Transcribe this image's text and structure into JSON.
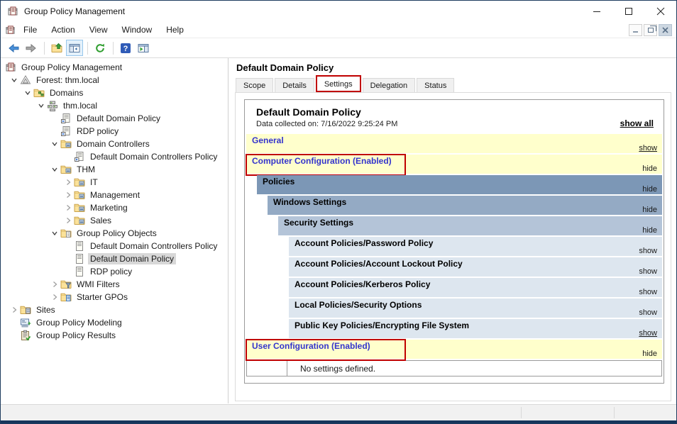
{
  "window": {
    "title": "Group Policy Management",
    "controls": [
      {
        "name": "minimize-button",
        "icon": "minimize-icon"
      },
      {
        "name": "maximize-button",
        "icon": "maximize-icon"
      },
      {
        "name": "close-button",
        "icon": "close-icon"
      }
    ]
  },
  "menu": {
    "items": [
      "File",
      "Action",
      "View",
      "Window",
      "Help"
    ],
    "mdi_controls": [
      {
        "name": "mdi-minimize-button",
        "icon": "minimize-icon"
      },
      {
        "name": "mdi-restore-button",
        "icon": "restore-icon"
      },
      {
        "name": "mdi-close-button",
        "icon": "close-icon"
      }
    ]
  },
  "toolbar": {
    "buttons": [
      {
        "name": "back-button",
        "icon": "back-arrow-icon"
      },
      {
        "name": "forward-button",
        "icon": "forward-arrow-icon"
      },
      {
        "sep": true
      },
      {
        "name": "up-one-level-button",
        "icon": "folder-up-icon"
      },
      {
        "name": "show-console-tree-button",
        "icon": "console-tree-icon",
        "active": true
      },
      {
        "sep": true
      },
      {
        "name": "refresh-button",
        "icon": "refresh-icon"
      },
      {
        "sep": true
      },
      {
        "name": "help-button",
        "icon": "help-icon"
      },
      {
        "name": "show-action-pane-button",
        "icon": "action-pane-icon"
      }
    ]
  },
  "tree": {
    "items": [
      {
        "label": "Group Policy Management",
        "level": 0,
        "chevron": "none",
        "icon": "gpmc-console-icon"
      },
      {
        "label": "Forest: thm.local",
        "level": 1,
        "chevron": "expanded",
        "icon": "forest-icon"
      },
      {
        "label": "Domains",
        "level": 2,
        "chevron": "expanded",
        "icon": "domains-folder-icon"
      },
      {
        "label": "thm.local",
        "level": 3,
        "chevron": "expanded",
        "icon": "domain-icon"
      },
      {
        "label": "Default Domain Policy",
        "level": 4,
        "chevron": "empty",
        "icon": "gpo-link-icon"
      },
      {
        "label": "RDP policy",
        "level": 4,
        "chevron": "empty",
        "icon": "gpo-link-icon"
      },
      {
        "label": "Domain Controllers",
        "level": 4,
        "chevron": "expanded",
        "icon": "ou-folder-icon"
      },
      {
        "label": "Default Domain Controllers Policy",
        "level": 5,
        "chevron": "empty",
        "icon": "gpo-link-icon"
      },
      {
        "label": "THM",
        "level": 4,
        "chevron": "expanded",
        "icon": "ou-folder-icon"
      },
      {
        "label": "IT",
        "level": 5,
        "chevron": "collapsed",
        "icon": "ou-folder-icon"
      },
      {
        "label": "Management",
        "level": 5,
        "chevron": "collapsed",
        "icon": "ou-folder-icon"
      },
      {
        "label": "Marketing",
        "level": 5,
        "chevron": "collapsed",
        "icon": "ou-folder-icon"
      },
      {
        "label": "Sales",
        "level": 5,
        "chevron": "collapsed",
        "icon": "ou-folder-icon"
      },
      {
        "label": "Group Policy Objects",
        "level": 4,
        "chevron": "expanded",
        "icon": "gpo-folder-icon"
      },
      {
        "label": "Default Domain Controllers Policy",
        "level": 5,
        "chevron": "empty",
        "icon": "gpo-icon"
      },
      {
        "label": "Default Domain Policy",
        "level": 5,
        "chevron": "empty",
        "icon": "gpo-icon",
        "selected": true
      },
      {
        "label": "RDP policy",
        "level": 5,
        "chevron": "empty",
        "icon": "gpo-icon"
      },
      {
        "label": "WMI Filters",
        "level": 4,
        "chevron": "collapsed",
        "icon": "wmi-filters-icon"
      },
      {
        "label": "Starter GPOs",
        "level": 4,
        "chevron": "collapsed",
        "icon": "starter-gpos-icon"
      },
      {
        "label": "Sites",
        "level": 1,
        "chevron": "collapsed",
        "icon": "sites-icon"
      },
      {
        "label": "Group Policy Modeling",
        "level": 1,
        "chevron": "empty",
        "icon": "modeling-icon"
      },
      {
        "label": "Group Policy Results",
        "level": 1,
        "chevron": "empty",
        "icon": "results-icon"
      }
    ]
  },
  "main": {
    "title": "Default Domain Policy",
    "tabs": [
      {
        "label": "Scope"
      },
      {
        "label": "Details"
      },
      {
        "label": "Settings",
        "active": true,
        "annotated": true
      },
      {
        "label": "Delegation"
      },
      {
        "label": "Status"
      }
    ]
  },
  "report": {
    "title": "Default Domain Policy",
    "collected": "Data collected on: 7/16/2022 9:25:24 PM",
    "show_all": "show all",
    "sections": [
      {
        "label": "General",
        "style": "yellow",
        "indent": 0,
        "link": "show",
        "underline": true,
        "label_color": "blue"
      },
      {
        "label": "Computer Configuration (Enabled)",
        "style": "yellow",
        "indent": 0,
        "link": "hide",
        "label_color": "blue",
        "annotated": true
      },
      {
        "label": "Policies",
        "style": "level1",
        "indent": 1,
        "link": "hide"
      },
      {
        "label": "Windows Settings",
        "style": "level2",
        "indent": 2,
        "link": "hide"
      },
      {
        "label": "Security Settings",
        "style": "level3",
        "indent": 3,
        "link": "hide"
      },
      {
        "label": "Account Policies/Password Policy",
        "style": "row",
        "indent": 4,
        "link": "show"
      },
      {
        "label": "Account Policies/Account Lockout Policy",
        "style": "row",
        "indent": 4,
        "link": "show"
      },
      {
        "label": "Account Policies/Kerberos Policy",
        "style": "row",
        "indent": 4,
        "link": "show"
      },
      {
        "label": "Local Policies/Security Options",
        "style": "row",
        "indent": 4,
        "link": "show"
      },
      {
        "label": "Public Key Policies/Encrypting File System",
        "style": "row",
        "indent": 4,
        "link": "show",
        "underline": true
      },
      {
        "label": "User Configuration (Enabled)",
        "style": "yellow",
        "indent": 0,
        "link": "hide",
        "label_color": "blue",
        "annotated": true
      }
    ],
    "empty_note": "No settings defined."
  },
  "colors": {
    "annotation_red": "#c00000",
    "band_yellow": "#ffffcc",
    "band_level1": "#7c97b6",
    "band_level2": "#94aac4",
    "band_level3": "#b4c4d8",
    "band_row": "#dde6ef",
    "header_blue_text": "#3333cc",
    "window_border": "#1e3c5f"
  }
}
